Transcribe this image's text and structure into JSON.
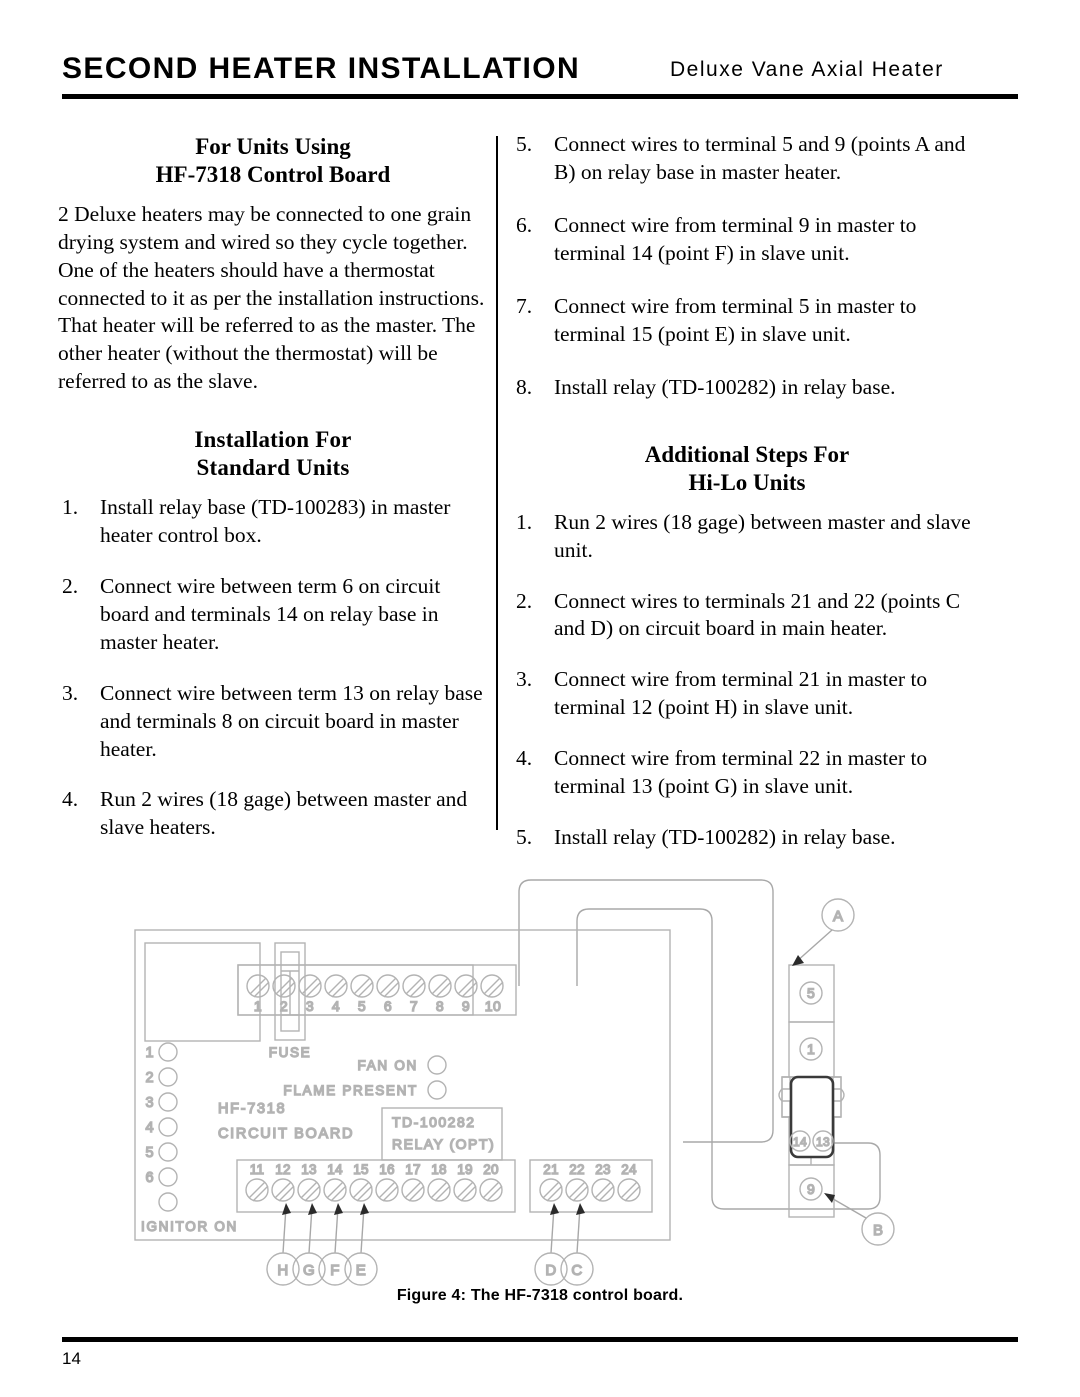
{
  "header": {
    "title": "SECOND HEATER INSTALLATION",
    "subtitle": "Deluxe Vane Axial Heater"
  },
  "left_column": {
    "section1": {
      "heading_line1": "For Units Using",
      "heading_line2": "HF-7318 Control Board",
      "paragraph": "2 Deluxe heaters may be connected to one grain drying system and wired so they cycle together. One of the heaters should have a thermostat connected to it as per the installation instructions. That heater will be referred to as the master. The other heater (without the thermostat) will be referred to as the slave."
    },
    "section2": {
      "heading_line1": "Installation For",
      "heading_line2": "Standard Units",
      "steps": [
        {
          "num": "1.",
          "text": "Install relay base (TD-100283) in master heater control box."
        },
        {
          "num": "2.",
          "text": "Connect wire between term 6 on circuit board and terminals 14 on relay base in master heater."
        },
        {
          "num": "3.",
          "text": "Connect wire between term 13 on relay base and terminals 8 on circuit board in master heater."
        },
        {
          "num": "4.",
          "text": "Run 2 wires (18 gage) between master and slave heaters."
        }
      ]
    }
  },
  "right_column": {
    "continued_steps": [
      {
        "num": "5.",
        "text": "Connect wires to terminal 5 and 9 (points A and B) on relay base in master heater."
      },
      {
        "num": "6.",
        "text": "Connect wire from terminal 9 in master to terminal 14 (point F) in slave unit."
      },
      {
        "num": "7.",
        "text": "Connect wire from terminal 5 in master to terminal 15 (point E) in slave unit."
      },
      {
        "num": "8.",
        "text": "Install relay (TD-100282) in relay base."
      }
    ],
    "section3": {
      "heading_line1": "Additional Steps For",
      "heading_line2": "Hi-Lo Units",
      "steps": [
        {
          "num": "1.",
          "text": "Run 2 wires (18 gage) between master and slave unit."
        },
        {
          "num": "2.",
          "text": "Connect wires to terminals 21 and 22 (points C and D) on circuit board in main heater."
        },
        {
          "num": "3.",
          "text": "Connect wire from terminal 21 in master to terminal 12 (point H) in slave unit."
        },
        {
          "num": "4.",
          "text": "Connect wire from terminal 22 in master to terminal 13 (point G) in slave unit."
        },
        {
          "num": "5.",
          "text": "Install relay (TD-100282) in relay base."
        }
      ]
    }
  },
  "figure": {
    "caption": "Figure 4: The HF-7318 control board.",
    "board_label_line1": "HF-7318",
    "board_label_line2": "CIRCUIT BOARD",
    "fuse_label": "FUSE",
    "fan_on_label": "FAN ON",
    "flame_present_label": "FLAME PRESENT",
    "ignitor_on_label": "IGNITOR ON",
    "relay_box_line1": "TD-100282",
    "relay_box_line2": "RELAY (OPT)",
    "led_numbers": [
      "1",
      "2",
      "3",
      "4",
      "5",
      "6"
    ],
    "top_terminals": [
      "1",
      "2",
      "3",
      "4",
      "5",
      "6",
      "7",
      "8",
      "9",
      "10"
    ],
    "bottom_terminals_left": [
      "11",
      "12",
      "13",
      "14",
      "15",
      "16",
      "17",
      "18",
      "19",
      "20"
    ],
    "bottom_terminals_right": [
      "21",
      "22",
      "23",
      "24"
    ],
    "relay_base_terminals": [
      "5",
      "1",
      "14",
      "13",
      "9"
    ],
    "callouts_bottom_left": [
      "H",
      "G",
      "F",
      "E"
    ],
    "callouts_bottom_right": [
      "D",
      "C"
    ],
    "callouts_relay": [
      "A",
      "B"
    ],
    "line_color": "#b3b3b3",
    "text_color": "#9a9a9a"
  },
  "footer": {
    "page_number": "14"
  }
}
